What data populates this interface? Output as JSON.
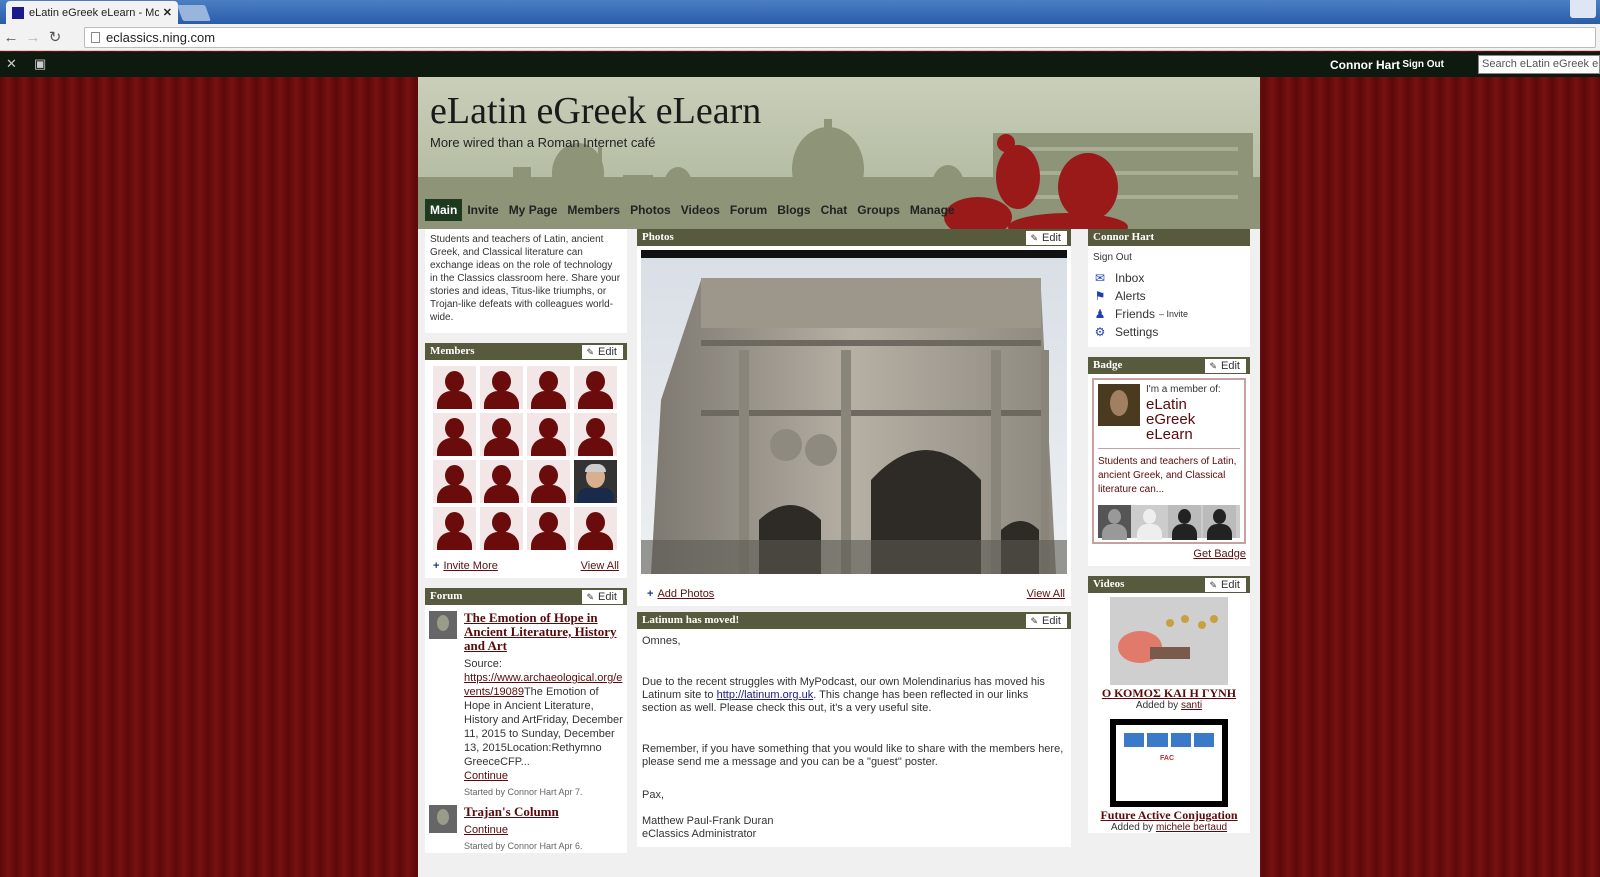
{
  "browser": {
    "tab_title": "eLatin eGreek eLearn - Mc",
    "tab_close": "✕",
    "url": "eclassics.ning.com"
  },
  "ningbar": {
    "user_name": "Connor Hart",
    "sign_out": "Sign Out",
    "search_placeholder": "Search eLatin eGreek eLe"
  },
  "site": {
    "title": "eLatin eGreek eLearn",
    "tagline": "More wired than a Roman Internet café",
    "nav": [
      "Main",
      "Invite",
      "My Page",
      "Members",
      "Photos",
      "Videos",
      "Forum",
      "Blogs",
      "Chat",
      "Groups",
      "Manage"
    ],
    "active_nav": "Main"
  },
  "edit_label": "Edit",
  "intro_text": "Students and teachers of Latin, ancient Greek, and Classical literature can exchange ideas on the role of technology in the Classics classroom here. Share your stories and ideas, Titus-like triumphs, or Trojan-like defeats with colleagues world-wide.",
  "members": {
    "title": "Members",
    "invite_more": "Invite More",
    "view_all": "View All"
  },
  "forum": {
    "title": "Forum",
    "topics": [
      {
        "title": "The Emotion of Hope in Ancient Literature, History and Art",
        "source_label": "Source:",
        "source_link": "https://www.archaeological.org/events/19089",
        "excerpt": "The Emotion of Hope in Ancient Literature, History and ArtFriday, December 11, 2015 to Sunday, December 13, 2015Location:Rethymno GreeceCFP...",
        "continue": "Continue",
        "meta": "Started by Connor Hart Apr 7."
      },
      {
        "title": "Trajan's Column",
        "continue": "Continue",
        "meta": "Started by Connor Hart Apr 6."
      }
    ]
  },
  "photos": {
    "title": "Photos",
    "add_photos": "Add Photos",
    "view_all": "View All"
  },
  "post": {
    "title": "Latinum has moved!",
    "greeting": "Omnes,",
    "p1_before": "Due to the recent struggles with MyPodcast, our own Molendinarius has moved his Latinum site to ",
    "p1_link": "http://latinum.org.uk",
    "p1_after": ".  This change has been reflected in our links section as well.  Please check this out, it's a very useful site.",
    "p2": "Remember, if you have something that you would like to share with the members here, please send me a message and you can be a \"guest\" poster.",
    "closing": "Pax,",
    "sig_name": "Matthew Paul-Frank Duran",
    "sig_role": "eClassics Administrator"
  },
  "userbox": {
    "title": "Connor Hart",
    "sign_out": "Sign Out",
    "inbox": "Inbox",
    "alerts": "Alerts",
    "friends": "Friends",
    "friends_invite": "– Invite",
    "settings": "Settings"
  },
  "badge": {
    "title": "Badge",
    "member_of": "I'm a member of:",
    "name": "eLatin eGreek eLearn",
    "desc": "Students and teachers of Latin, ancient Greek, and Classical literature can...",
    "get_badge": "Get Badge"
  },
  "videos": {
    "title": "Videos",
    "items": [
      {
        "title": "Ο ΚΟΜΟΣ ΚΑΙ Η ΓΥΝΗ",
        "added_by_label": "Added by",
        "author": "santi"
      },
      {
        "title": "Future Active Conjugation",
        "added_by_label": "Added by",
        "author": "michele bertaud",
        "thumb_text": "FAC"
      }
    ]
  },
  "colors": {
    "module_header": "#575a3c",
    "link": "#5a1010",
    "page_bg": "#6b0c0c",
    "ningbar": "#0e1a0e"
  }
}
